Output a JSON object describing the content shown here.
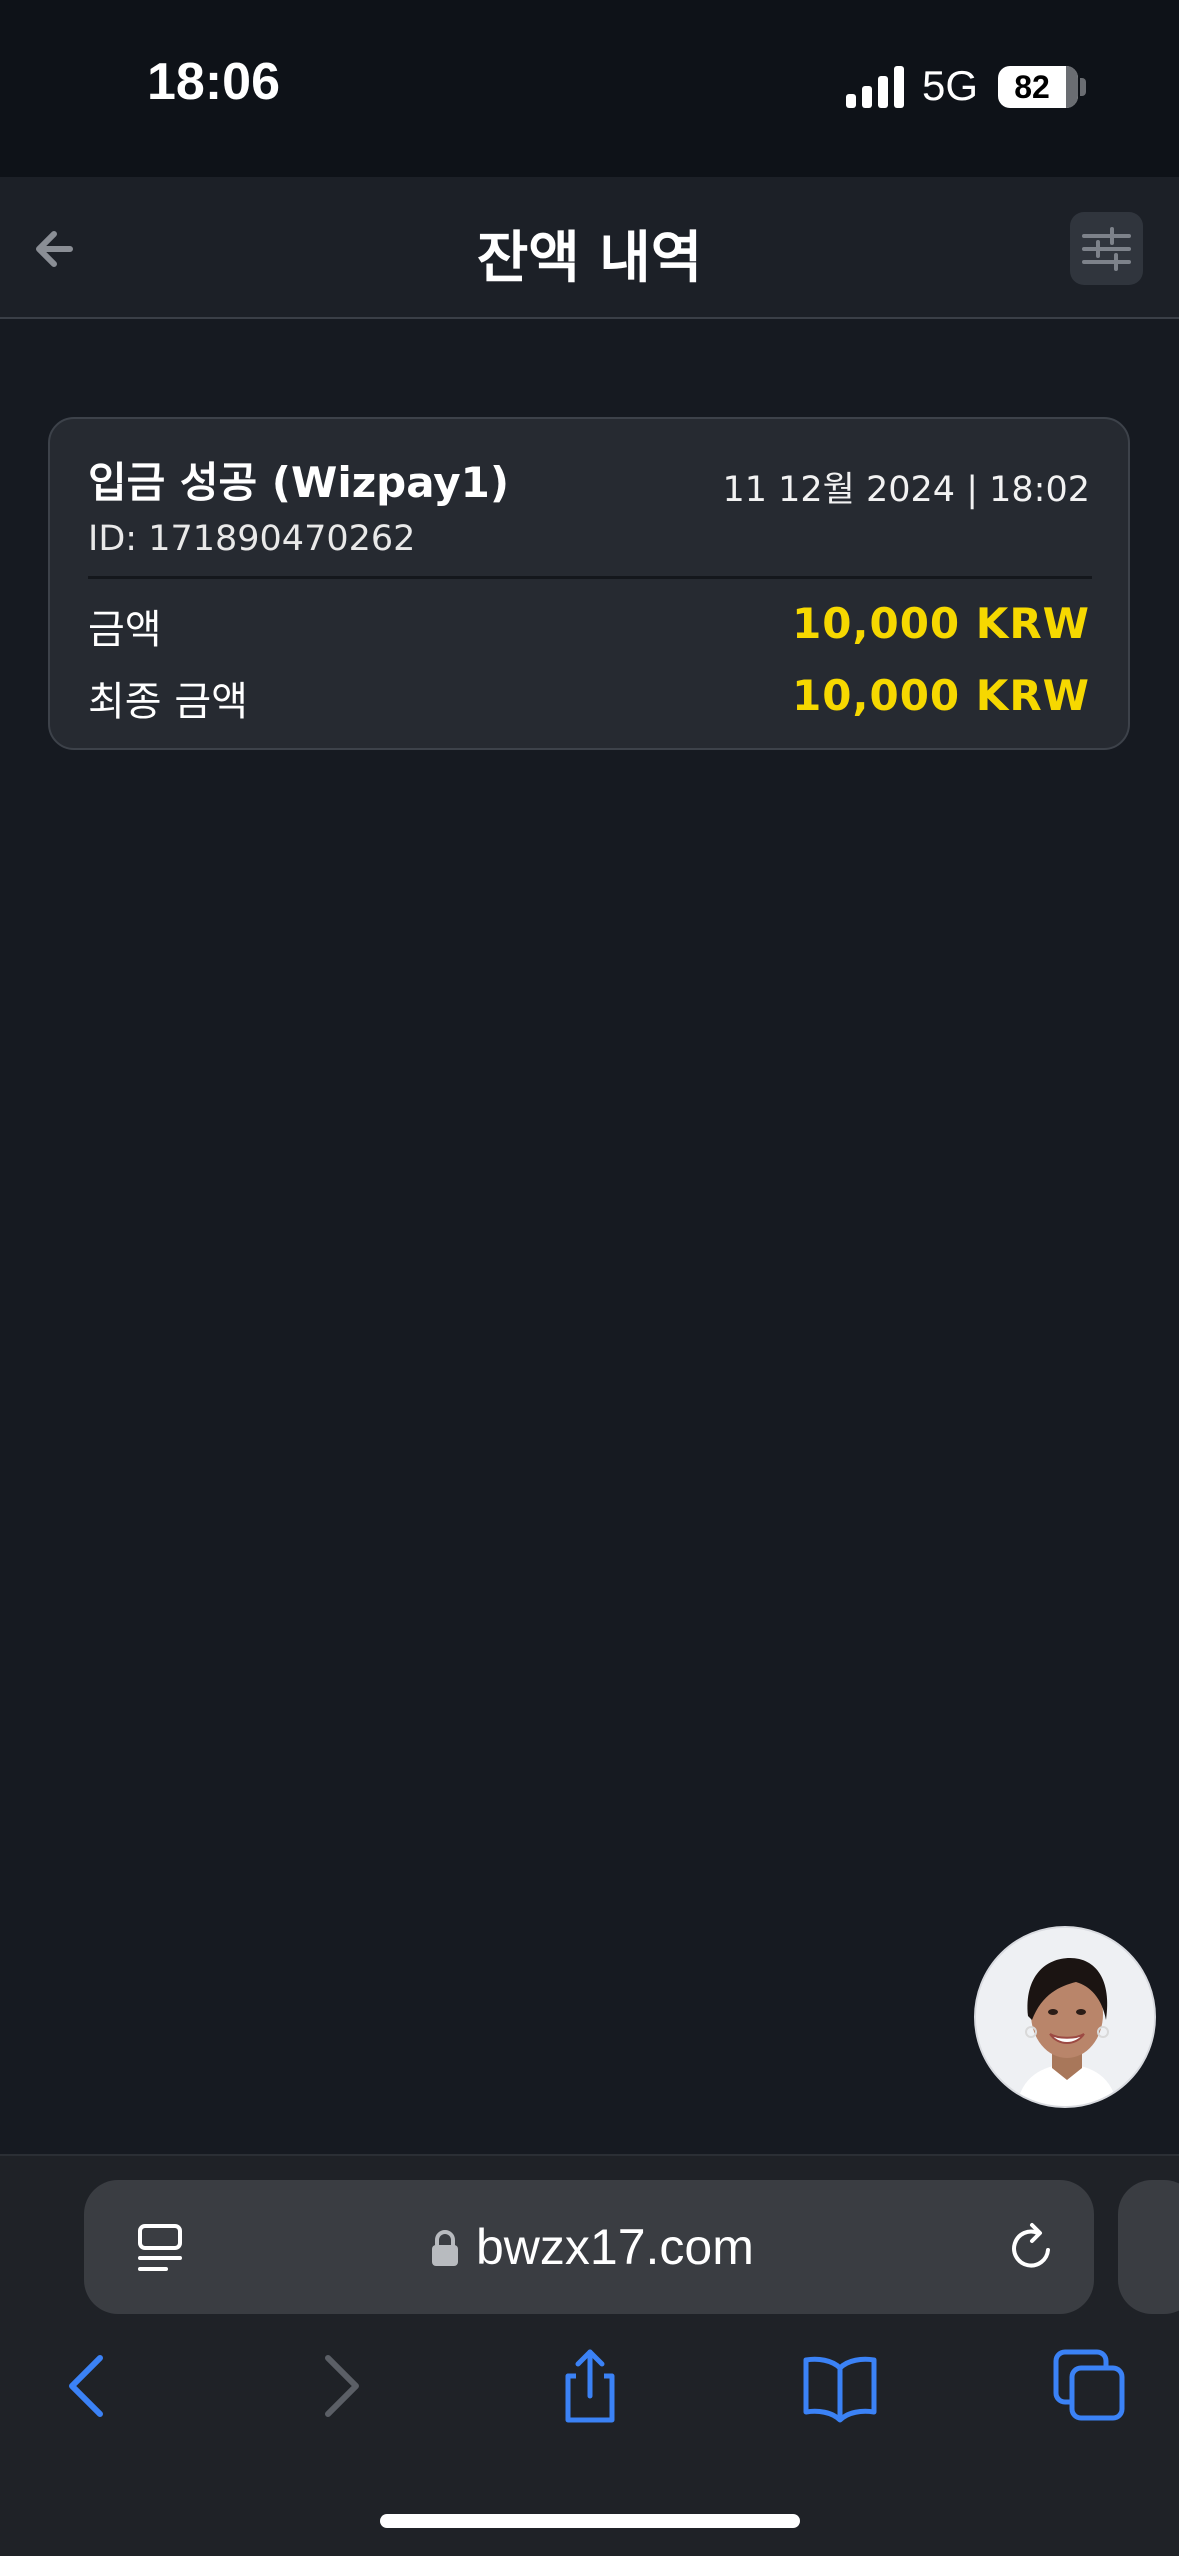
{
  "status_bar": {
    "time": "18:06",
    "network": "5G",
    "battery": "82"
  },
  "header": {
    "title": "잔액 내역",
    "back_icon": "arrow-left-icon",
    "filter_icon": "sliders-icon"
  },
  "transaction": {
    "title": "입금 성공 (Wizpay1)",
    "date": "11 12월 2024 | 18:02",
    "id": "ID: 171890470262",
    "rows": [
      {
        "label": "금액",
        "value": "10,000 KRW"
      },
      {
        "label": "최종 금액",
        "value": "10,000 KRW"
      }
    ]
  },
  "browser": {
    "url": "bwzx17.com",
    "icons": [
      "reader-icon",
      "lock-icon",
      "reload-icon",
      "back-chevron-icon",
      "forward-chevron-icon",
      "share-icon",
      "bookmarks-icon",
      "tabs-icon"
    ]
  },
  "colors": {
    "background": "#161a21",
    "card": "#262a31",
    "amount": "#f6d800",
    "safari_blue": "#3b82f6"
  }
}
